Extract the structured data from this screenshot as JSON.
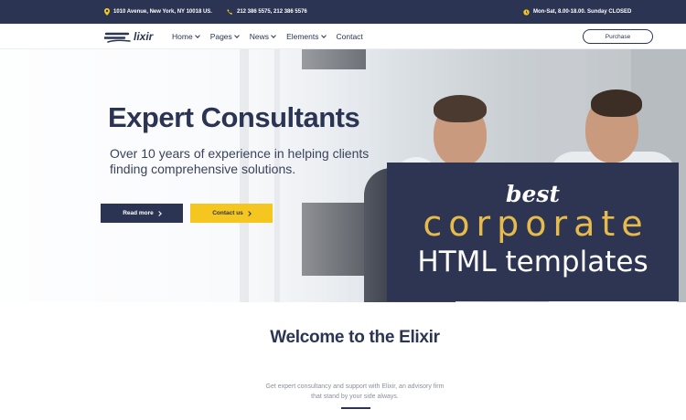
{
  "topbar": {
    "address": "1010 Avenue, New York, NY 10018 US.",
    "phone": "212 386 5575, 212 386 5576",
    "hours": "Mon-Sat, 8.00-18.00. Sunday CLOSED"
  },
  "navbar": {
    "logo_text": "lixir",
    "menu": [
      {
        "label": "Home",
        "dropdown": true
      },
      {
        "label": "Pages",
        "dropdown": true
      },
      {
        "label": "News",
        "dropdown": true
      },
      {
        "label": "Elements",
        "dropdown": true
      },
      {
        "label": "Contact",
        "dropdown": false
      }
    ],
    "purchase_label": "Purchase"
  },
  "hero": {
    "title": "Expert Consultants",
    "subtitle": "Over 10 years of experience in helping clients finding comprehensive solutions.",
    "primary_button": "Read more",
    "secondary_button": "Contact us"
  },
  "badge": {
    "line1": "best",
    "line2": "corporate",
    "line3": "HTML templates"
  },
  "welcome": {
    "title": "Welcome to the Elixir",
    "text_line1": "Get expert consultancy and support with Elixir, an advisory firm",
    "text_line2": "that stand by your side always."
  },
  "colors": {
    "navy": "#2b3553",
    "yellow": "#f4c61f",
    "gold": "#e6bb4b",
    "muted_text": "#8a8f9b"
  },
  "icons": [
    "location-pin-icon",
    "phone-icon",
    "clock-icon",
    "chevron-down-icon",
    "chevron-right-icon"
  ]
}
